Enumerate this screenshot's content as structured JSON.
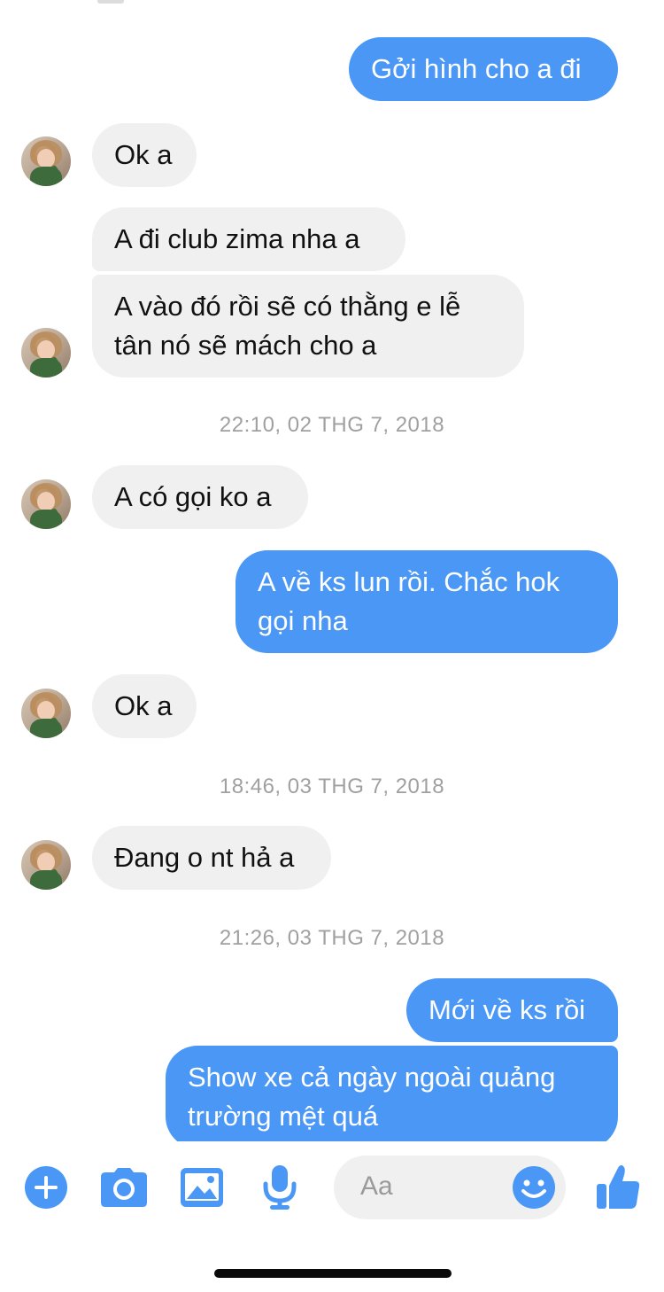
{
  "conversation": {
    "messages": [
      {
        "text": "Gởi hình cho a đi"
      },
      {
        "text": "Ok a"
      },
      {
        "text": "A đi club zima nha a"
      },
      {
        "text": "A vào đó rồi sẽ có thằng e lễ\ntân nó sẽ mách cho a"
      },
      {
        "text": "A có gọi ko a"
      },
      {
        "text": "A về ks lun rồi. Chắc hok\ngọi nha"
      },
      {
        "text": "Ok a"
      },
      {
        "text": "Đang o nt hả a"
      },
      {
        "text": "Mới về ks rồi"
      },
      {
        "text": "Show xe cả ngày ngoài quảng\ntrường mệt quá"
      }
    ],
    "timestamps": [
      "22:10, 02 THG 7, 2018",
      "18:46, 03 THG 7, 2018",
      "21:26, 03 THG 7, 2018"
    ]
  },
  "composer": {
    "placeholder": "Aa",
    "icons": [
      "plus-icon",
      "camera-icon",
      "image-icon",
      "microphone-icon",
      "emoji-icon",
      "thumbs-up-icon"
    ]
  },
  "colors": {
    "accent": "#4a97f5",
    "incoming_bubble": "#f0f0f0",
    "timestamp": "#a0a0a0"
  }
}
